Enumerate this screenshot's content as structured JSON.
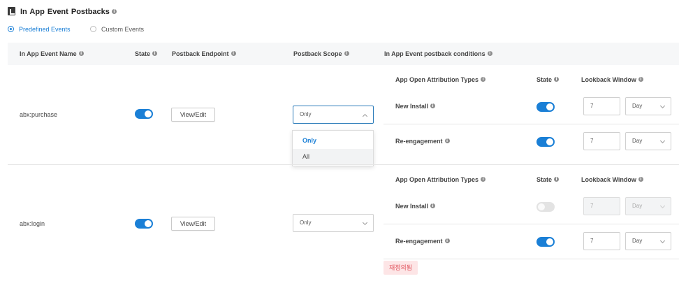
{
  "header": {
    "title": "In App Event Postbacks"
  },
  "event_type_tabs": [
    {
      "label": "Predefined Events",
      "selected": true
    },
    {
      "label": "Custom Events",
      "selected": false
    }
  ],
  "columns": {
    "event_name": "In App Event Name",
    "state": "State",
    "endpoint": "Postback Endpoint",
    "scope": "Postback Scope",
    "conditions": "In App Event postback conditions"
  },
  "conditions_headers": {
    "attribution_types": "App Open Attribution Types",
    "state": "State",
    "lookback": "Lookback Window"
  },
  "rows": [
    {
      "event_name": "abx:purchase",
      "state_on": true,
      "endpoint_button": "View/Edit",
      "scope": "Only",
      "scope_dropdown_open": true,
      "scope_options": [
        "Only",
        "All"
      ],
      "conditions": [
        {
          "type": "New Install",
          "state_on": true,
          "lookback_value": "7",
          "lookback_unit": "Day",
          "disabled": false
        },
        {
          "type": "Re-engagement",
          "state_on": true,
          "lookback_value": "7",
          "lookback_unit": "Day",
          "disabled": false
        }
      ]
    },
    {
      "event_name": "abx:login",
      "state_on": true,
      "endpoint_button": "View/Edit",
      "scope": "Only",
      "scope_dropdown_open": false,
      "conditions": [
        {
          "type": "New Install",
          "state_on": false,
          "lookback_value": "7",
          "lookback_unit": "Day",
          "disabled": true
        },
        {
          "type": "Re-engagement",
          "state_on": true,
          "lookback_value": "7",
          "lookback_unit": "Day",
          "disabled": false
        }
      ]
    }
  ],
  "status_badge": {
    "label": "재정의됨",
    "color": "#e0505a",
    "background": "#fde5e6"
  },
  "colors": {
    "accent": "#1a7fd6",
    "header_bg": "#f6f7f8"
  }
}
